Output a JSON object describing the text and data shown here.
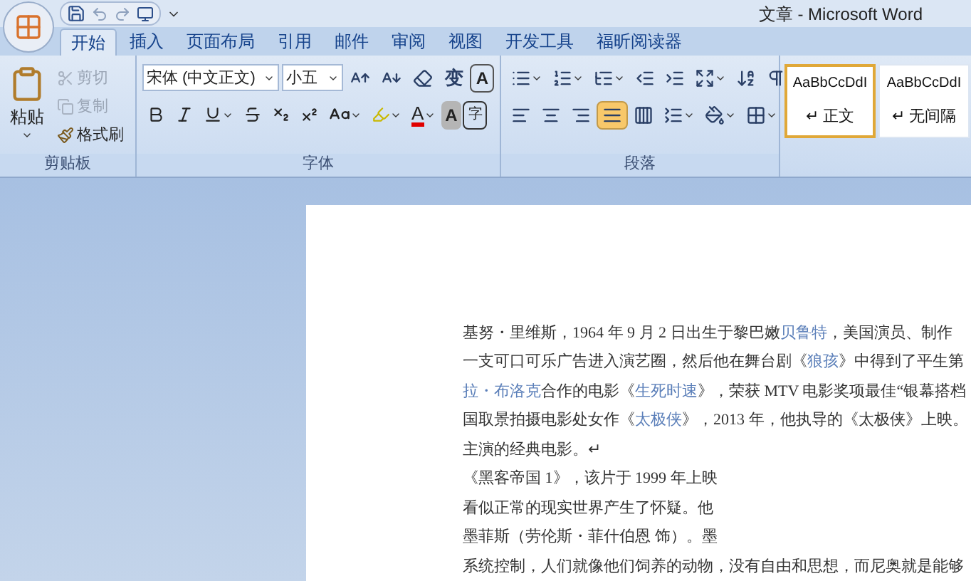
{
  "window": {
    "title": "文章 - Microsoft Word"
  },
  "tabs": [
    {
      "label": "开始",
      "selected": true
    },
    {
      "label": "插入",
      "selected": false
    },
    {
      "label": "页面布局",
      "selected": false
    },
    {
      "label": "引用",
      "selected": false
    },
    {
      "label": "邮件",
      "selected": false
    },
    {
      "label": "审阅",
      "selected": false
    },
    {
      "label": "视图",
      "selected": false
    },
    {
      "label": "开发工具",
      "selected": false
    },
    {
      "label": "福昕阅读器",
      "selected": false
    }
  ],
  "clipboard": {
    "label": "剪贴板",
    "paste": "粘贴",
    "items": [
      {
        "kind": "cut",
        "label": "剪切",
        "disabled": true
      },
      {
        "kind": "copy",
        "label": "复制",
        "disabled": true
      },
      {
        "kind": "painter",
        "label": "格式刷",
        "disabled": false
      }
    ]
  },
  "font": {
    "label": "字体",
    "font_name": "宋体 (中文正文)",
    "font_size": "小五",
    "phonetic_glyph": "变",
    "border_glyph": "A",
    "font_color_glyph": "A",
    "shading_glyph": "A",
    "enclosed_glyph": "字"
  },
  "paragraph": {
    "label": "段落",
    "alignments": [
      {
        "kind": "left",
        "selected": false
      },
      {
        "kind": "center",
        "selected": false
      },
      {
        "kind": "right",
        "selected": false
      },
      {
        "kind": "justify",
        "selected": true
      },
      {
        "kind": "distributed",
        "selected": false
      }
    ]
  },
  "styles": [
    {
      "sample": "AaBbCcDdI",
      "name": "↵ 正文",
      "selected": true
    },
    {
      "sample": "AaBbCcDdI",
      "name": "↵ 无间隔",
      "selected": false
    }
  ],
  "document": {
    "lines": [
      {
        "segments": [
          {
            "text": "基努・里维斯，1964 年 9 月 2 日出生于黎巴嫩",
            "link": false
          },
          {
            "text": "贝鲁特",
            "link": true
          },
          {
            "text": "，美国演员、制作",
            "link": false
          }
        ]
      },
      {
        "segments": [
          {
            "text": "一支可口可乐广告进入演艺圈，然后他在舞台剧《",
            "link": false
          },
          {
            "text": "狼孩",
            "link": true
          },
          {
            "text": "》中得到了平生第",
            "link": false
          }
        ]
      },
      {
        "segments": [
          {
            "text": "拉・布洛克",
            "link": true
          },
          {
            "text": "合作的电影《",
            "link": false
          },
          {
            "text": "生死时速",
            "link": true
          },
          {
            "text": "》，荣获 MTV 电影奖项最佳“银幕搭档",
            "link": false
          }
        ]
      },
      {
        "segments": [
          {
            "text": "国取景拍摄电影处女作《",
            "link": false
          },
          {
            "text": "太极侠",
            "link": true
          },
          {
            "text": "》，2013 年，他执导的《太极侠》上映。",
            "link": false
          }
        ]
      },
      {
        "segments": [
          {
            "text": "主演的经典电影。↵",
            "link": false
          }
        ]
      },
      {
        "segments": [
          {
            "text": "《黑客帝国 1》，该片于 1999 年上映",
            "link": false
          }
        ]
      },
      {
        "segments": [
          {
            "text": "看似正常的现实世界产生了怀疑。他",
            "link": false
          }
        ]
      },
      {
        "segments": [
          {
            "text": "墨菲斯（劳伦斯・菲什伯恩 饰）。墨",
            "link": false
          }
        ]
      },
      {
        "segments": [
          {
            "text": "系统控制，人们就像他们饲养的动物，没有自由和思想，而尼奥就是能够",
            "link": false
          }
        ]
      }
    ]
  }
}
